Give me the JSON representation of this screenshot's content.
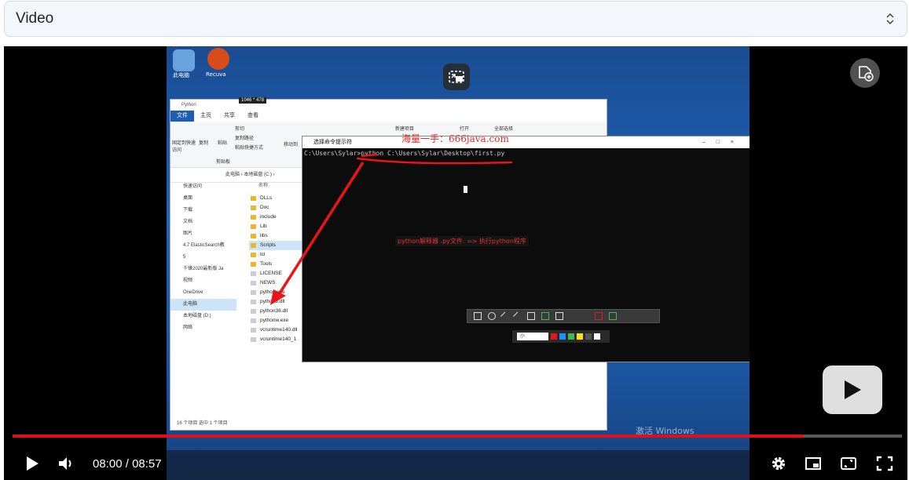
{
  "select": {
    "label": "Video"
  },
  "player": {
    "current_time": "08:00",
    "separator": " / ",
    "duration": "08:57",
    "progress": 0.89,
    "accent_color": "#e00f1b"
  },
  "icons": {
    "chevron": "up-down-chevron-icon",
    "pip": "picture-in-picture-icon",
    "corner_action": "settings-badge-icon",
    "big_play": "play-icon",
    "play": "play-icon",
    "volume": "volume-icon",
    "settings": "gear-icon",
    "miniplayer": "miniplayer-icon",
    "theater": "theater-icon",
    "fullscreen": "fullscreen-icon"
  },
  "video_frame": {
    "desktop_icons": [
      "此电脑",
      "Recuva"
    ],
    "dimension_badge": "1046 * 478",
    "explorer": {
      "title": "Python",
      "tabs": [
        "文件",
        "主页",
        "共享",
        "查看"
      ],
      "ribbon_items": [
        "剪切",
        "复制路径",
        "粘贴快捷方式",
        "固定到快速访问",
        "复制",
        "粘贴",
        "剪贴板",
        "移动到",
        "新建项目",
        "打开",
        "全部选择"
      ],
      "address": "此电脑 › 本地磁盘 (C:) ›",
      "nav": [
        "快速访问",
        "桌面",
        "下载",
        "文档",
        "图片",
        "4.7 ElasticSearch教",
        "5",
        "千锋2020最新版 Ja",
        "视频",
        "OneDrive",
        "此电脑",
        "本地磁盘 (D:)",
        "网络"
      ],
      "column_header": "名称",
      "files": [
        "DLLs",
        "Doc",
        "include",
        "Lib",
        "libs",
        "Scripts",
        "tcl",
        "Tools",
        "LICENSE",
        "NEWS",
        "python.exe",
        "python3.dll",
        "python38.dll",
        "pythonw.exe",
        "vcruntime140.dll",
        "vcruntime140_1"
      ],
      "status": "16 个项目    选中 1 个项目"
    },
    "cmd": {
      "title": "选择命令提示符",
      "line": "C:\\Users\\Sylar>python C:\\Users\\Sylar\\Desktop\\first.py",
      "watermark": "海量一手：666java.com",
      "note": "python解释器 .py文件. => 执行python程序",
      "size_select": "小"
    },
    "activation": "激活 Windows"
  }
}
